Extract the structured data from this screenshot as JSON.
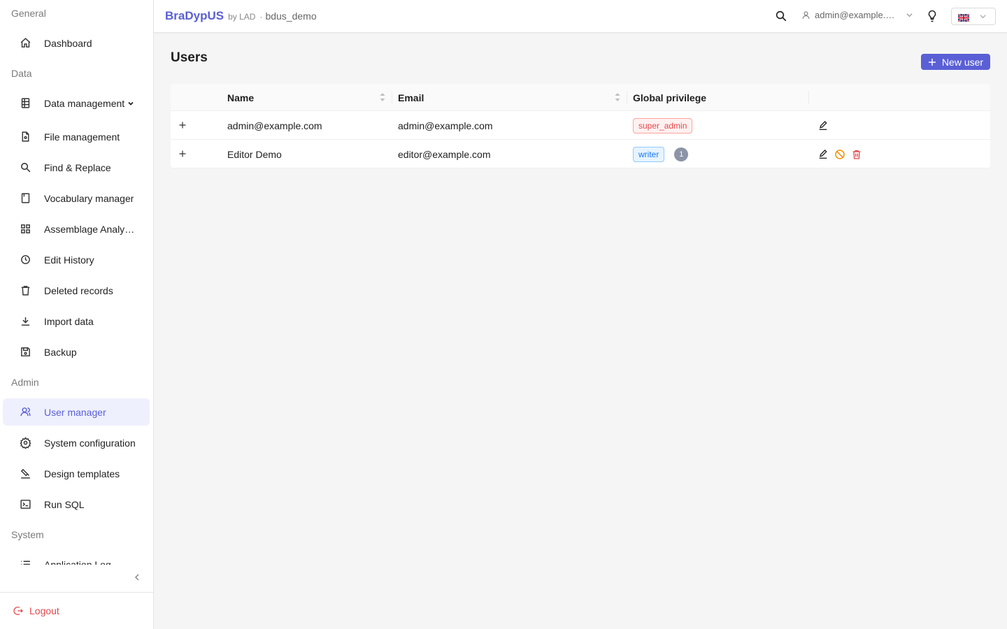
{
  "brand": {
    "name": "BraDypUS",
    "by": "by LAD",
    "sep": "·",
    "app": "bdus_demo"
  },
  "topbar": {
    "user": "admin@example.com",
    "lang_flag": "uk-flag-icon"
  },
  "sidebar": {
    "sections": {
      "general": "General",
      "data": "Data",
      "admin": "Admin",
      "system": "System"
    },
    "items": [
      {
        "label": "Dashboard",
        "icon": "home-icon"
      },
      {
        "label": "Data management",
        "icon": "table-icon"
      },
      {
        "label": "File management",
        "icon": "file-icon"
      },
      {
        "label": "Find & Replace",
        "icon": "search-icon"
      },
      {
        "label": "Vocabulary manager",
        "icon": "book-icon"
      },
      {
        "label": "Assemblage Analysis",
        "icon": "grid-icon"
      },
      {
        "label": "Edit History",
        "icon": "history-icon"
      },
      {
        "label": "Deleted records",
        "icon": "trash-icon"
      },
      {
        "label": "Import data",
        "icon": "download-icon"
      },
      {
        "label": "Backup",
        "icon": "save-icon"
      },
      {
        "label": "User manager",
        "icon": "users-icon"
      },
      {
        "label": "System configuration",
        "icon": "gear-icon"
      },
      {
        "label": "Design templates",
        "icon": "brush-icon"
      },
      {
        "label": "Run SQL",
        "icon": "terminal-icon"
      },
      {
        "label": "Application Log",
        "icon": "list-icon"
      }
    ],
    "logout": "Logout"
  },
  "main": {
    "title": "Users",
    "new_user": "New user",
    "columns": {
      "name": "Name",
      "email": "Email",
      "privilege": "Global privilege"
    },
    "rows": [
      {
        "name": "admin@example.com",
        "email": "admin@example.com",
        "privilege": "super_admin"
      },
      {
        "name": "Editor Demo",
        "email": "editor@example.com",
        "privilege": "writer",
        "count": "1"
      }
    ]
  },
  "colors": {
    "accent": "#5a5fd6",
    "danger": "#e5484d",
    "warning": "#f08c00",
    "info": "#1677ff"
  }
}
